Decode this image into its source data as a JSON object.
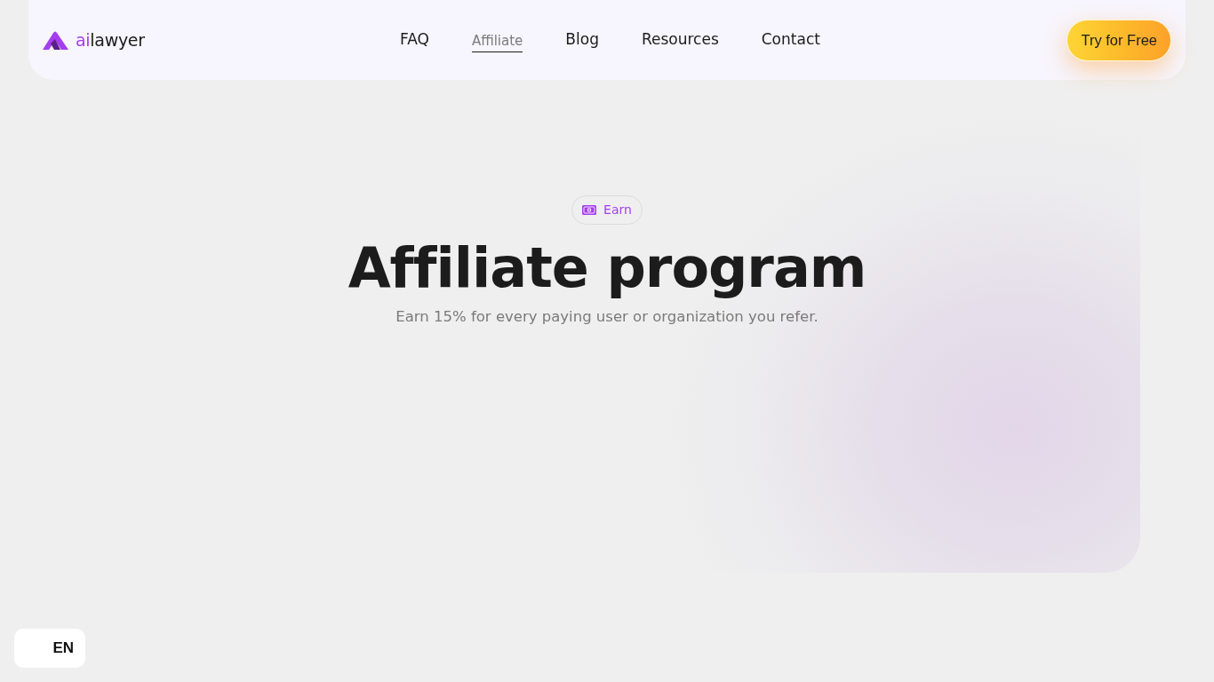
{
  "header": {
    "logo": {
      "accent": "ai",
      "rest": "lawyer"
    },
    "nav": [
      {
        "label": "FAQ",
        "selected": false
      },
      {
        "label": "Affiliate",
        "selected": true
      },
      {
        "label": "Blog",
        "selected": false
      },
      {
        "label": "Resources",
        "selected": false
      },
      {
        "label": "Contact",
        "selected": false
      }
    ],
    "cta_button": "Try for Free"
  },
  "hero": {
    "badge": "Earn",
    "title": "Affiliate program",
    "subtitle": "Earn 15% for every paying user or organization you refer."
  },
  "language_button": "EN"
}
